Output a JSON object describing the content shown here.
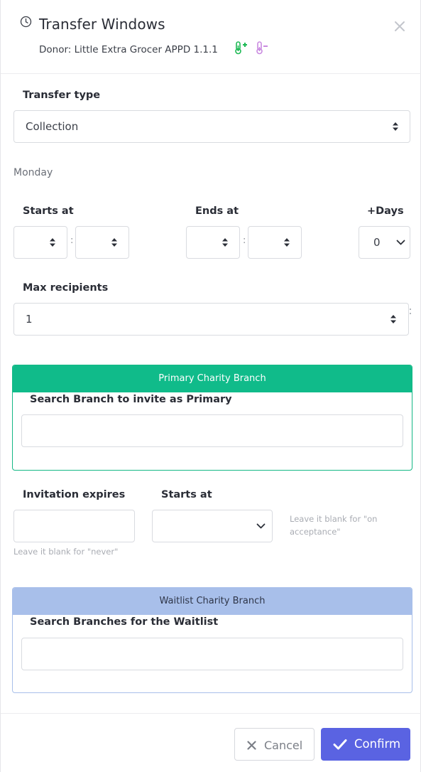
{
  "header": {
    "title": "Transfer Windows",
    "donor": "Donor: Little Extra Grocer APPD 1.1.1"
  },
  "icons": {
    "clock": "clock-icon",
    "close": "close-icon",
    "thermo_plus": "thermometer-plus-icon",
    "thermo_minus": "thermometer-minus-icon"
  },
  "colors": {
    "accent": "#5a63e2",
    "primary_panel": "#10bb8a",
    "waitlist_panel": "#a8bfea",
    "thermo_plus": "#1db954",
    "thermo_minus": "#c98ae0"
  },
  "transfer": {
    "label": "Transfer type",
    "value": "Collection"
  },
  "day": "Monday",
  "time": {
    "starts_label": "Starts at",
    "ends_label": "Ends at",
    "days_label": "+Days",
    "days_value": "0",
    "separator": ":"
  },
  "max": {
    "label": "Max recipients",
    "value": "1"
  },
  "primary": {
    "header": "Primary Charity Branch",
    "search_label": "Search Branch to invite as Primary",
    "search_value": ""
  },
  "invitation": {
    "expires_label": "Invitation expires",
    "expires_hint": "Leave it blank for \"never\"",
    "starts_label": "Starts at",
    "starts_hint": "Leave it blank for \"on acceptance\""
  },
  "waitlist": {
    "header": "Waitlist Charity Branch",
    "search_label": "Search Branches for the Waitlist",
    "search_value": ""
  },
  "footer": {
    "cancel_label": "Cancel",
    "confirm_label": "Confirm"
  }
}
